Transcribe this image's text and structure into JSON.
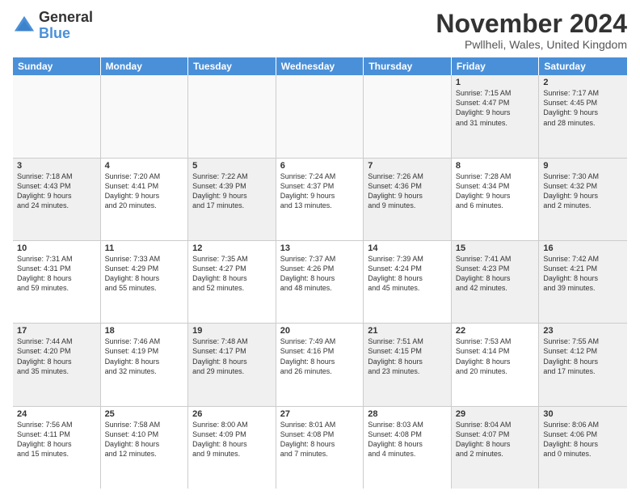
{
  "logo": {
    "general": "General",
    "blue": "Blue"
  },
  "title": "November 2024",
  "location": "Pwllheli, Wales, United Kingdom",
  "header_days": [
    "Sunday",
    "Monday",
    "Tuesday",
    "Wednesday",
    "Thursday",
    "Friday",
    "Saturday"
  ],
  "rows": [
    [
      {
        "day": "",
        "empty": true,
        "lines": []
      },
      {
        "day": "",
        "empty": true,
        "lines": []
      },
      {
        "day": "",
        "empty": true,
        "lines": []
      },
      {
        "day": "",
        "empty": true,
        "lines": []
      },
      {
        "day": "",
        "empty": true,
        "lines": []
      },
      {
        "day": "1",
        "lines": [
          "Sunrise: 7:15 AM",
          "Sunset: 4:47 PM",
          "Daylight: 9 hours",
          "and 31 minutes."
        ]
      },
      {
        "day": "2",
        "lines": [
          "Sunrise: 7:17 AM",
          "Sunset: 4:45 PM",
          "Daylight: 9 hours",
          "and 28 minutes."
        ]
      }
    ],
    [
      {
        "day": "3",
        "lines": [
          "Sunrise: 7:18 AM",
          "Sunset: 4:43 PM",
          "Daylight: 9 hours",
          "and 24 minutes."
        ]
      },
      {
        "day": "4",
        "lines": [
          "Sunrise: 7:20 AM",
          "Sunset: 4:41 PM",
          "Daylight: 9 hours",
          "and 20 minutes."
        ]
      },
      {
        "day": "5",
        "lines": [
          "Sunrise: 7:22 AM",
          "Sunset: 4:39 PM",
          "Daylight: 9 hours",
          "and 17 minutes."
        ]
      },
      {
        "day": "6",
        "lines": [
          "Sunrise: 7:24 AM",
          "Sunset: 4:37 PM",
          "Daylight: 9 hours",
          "and 13 minutes."
        ]
      },
      {
        "day": "7",
        "lines": [
          "Sunrise: 7:26 AM",
          "Sunset: 4:36 PM",
          "Daylight: 9 hours",
          "and 9 minutes."
        ]
      },
      {
        "day": "8",
        "lines": [
          "Sunrise: 7:28 AM",
          "Sunset: 4:34 PM",
          "Daylight: 9 hours",
          "and 6 minutes."
        ]
      },
      {
        "day": "9",
        "lines": [
          "Sunrise: 7:30 AM",
          "Sunset: 4:32 PM",
          "Daylight: 9 hours",
          "and 2 minutes."
        ]
      }
    ],
    [
      {
        "day": "10",
        "lines": [
          "Sunrise: 7:31 AM",
          "Sunset: 4:31 PM",
          "Daylight: 8 hours",
          "and 59 minutes."
        ]
      },
      {
        "day": "11",
        "lines": [
          "Sunrise: 7:33 AM",
          "Sunset: 4:29 PM",
          "Daylight: 8 hours",
          "and 55 minutes."
        ]
      },
      {
        "day": "12",
        "lines": [
          "Sunrise: 7:35 AM",
          "Sunset: 4:27 PM",
          "Daylight: 8 hours",
          "and 52 minutes."
        ]
      },
      {
        "day": "13",
        "lines": [
          "Sunrise: 7:37 AM",
          "Sunset: 4:26 PM",
          "Daylight: 8 hours",
          "and 48 minutes."
        ]
      },
      {
        "day": "14",
        "lines": [
          "Sunrise: 7:39 AM",
          "Sunset: 4:24 PM",
          "Daylight: 8 hours",
          "and 45 minutes."
        ]
      },
      {
        "day": "15",
        "lines": [
          "Sunrise: 7:41 AM",
          "Sunset: 4:23 PM",
          "Daylight: 8 hours",
          "and 42 minutes."
        ]
      },
      {
        "day": "16",
        "lines": [
          "Sunrise: 7:42 AM",
          "Sunset: 4:21 PM",
          "Daylight: 8 hours",
          "and 39 minutes."
        ]
      }
    ],
    [
      {
        "day": "17",
        "lines": [
          "Sunrise: 7:44 AM",
          "Sunset: 4:20 PM",
          "Daylight: 8 hours",
          "and 35 minutes."
        ]
      },
      {
        "day": "18",
        "lines": [
          "Sunrise: 7:46 AM",
          "Sunset: 4:19 PM",
          "Daylight: 8 hours",
          "and 32 minutes."
        ]
      },
      {
        "day": "19",
        "lines": [
          "Sunrise: 7:48 AM",
          "Sunset: 4:17 PM",
          "Daylight: 8 hours",
          "and 29 minutes."
        ]
      },
      {
        "day": "20",
        "lines": [
          "Sunrise: 7:49 AM",
          "Sunset: 4:16 PM",
          "Daylight: 8 hours",
          "and 26 minutes."
        ]
      },
      {
        "day": "21",
        "lines": [
          "Sunrise: 7:51 AM",
          "Sunset: 4:15 PM",
          "Daylight: 8 hours",
          "and 23 minutes."
        ]
      },
      {
        "day": "22",
        "lines": [
          "Sunrise: 7:53 AM",
          "Sunset: 4:14 PM",
          "Daylight: 8 hours",
          "and 20 minutes."
        ]
      },
      {
        "day": "23",
        "lines": [
          "Sunrise: 7:55 AM",
          "Sunset: 4:12 PM",
          "Daylight: 8 hours",
          "and 17 minutes."
        ]
      }
    ],
    [
      {
        "day": "24",
        "lines": [
          "Sunrise: 7:56 AM",
          "Sunset: 4:11 PM",
          "Daylight: 8 hours",
          "and 15 minutes."
        ]
      },
      {
        "day": "25",
        "lines": [
          "Sunrise: 7:58 AM",
          "Sunset: 4:10 PM",
          "Daylight: 8 hours",
          "and 12 minutes."
        ]
      },
      {
        "day": "26",
        "lines": [
          "Sunrise: 8:00 AM",
          "Sunset: 4:09 PM",
          "Daylight: 8 hours",
          "and 9 minutes."
        ]
      },
      {
        "day": "27",
        "lines": [
          "Sunrise: 8:01 AM",
          "Sunset: 4:08 PM",
          "Daylight: 8 hours",
          "and 7 minutes."
        ]
      },
      {
        "day": "28",
        "lines": [
          "Sunrise: 8:03 AM",
          "Sunset: 4:08 PM",
          "Daylight: 8 hours",
          "and 4 minutes."
        ]
      },
      {
        "day": "29",
        "lines": [
          "Sunrise: 8:04 AM",
          "Sunset: 4:07 PM",
          "Daylight: 8 hours",
          "and 2 minutes."
        ]
      },
      {
        "day": "30",
        "lines": [
          "Sunrise: 8:06 AM",
          "Sunset: 4:06 PM",
          "Daylight: 8 hours",
          "and 0 minutes."
        ]
      }
    ]
  ]
}
